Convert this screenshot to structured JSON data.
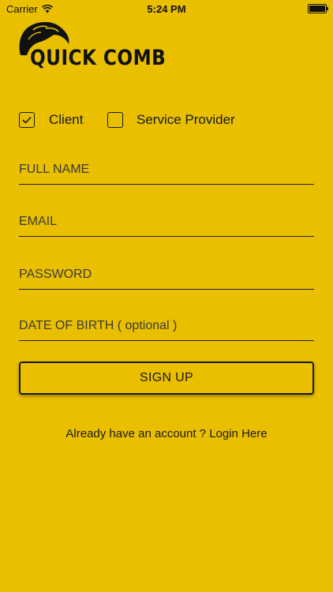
{
  "status_bar": {
    "carrier": "Carrier",
    "time": "5:24 PM"
  },
  "logo": {
    "text": "QUICK COMB"
  },
  "roles": {
    "client": {
      "label": "Client",
      "checked": true
    },
    "provider": {
      "label": "Service Provider",
      "checked": false
    }
  },
  "form": {
    "full_name": {
      "placeholder": "FULL NAME",
      "value": ""
    },
    "email": {
      "placeholder": "EMAIL",
      "value": ""
    },
    "password": {
      "placeholder": "PASSWORD",
      "value": ""
    },
    "dob": {
      "placeholder": "DATE OF BIRTH ( optional )",
      "value": ""
    }
  },
  "signup_button": {
    "label": "SIGN UP"
  },
  "login_link": {
    "text": "Already have an account ? Login Here"
  },
  "colors": {
    "background": "#E9BF00",
    "text": "#1a1a1a"
  }
}
